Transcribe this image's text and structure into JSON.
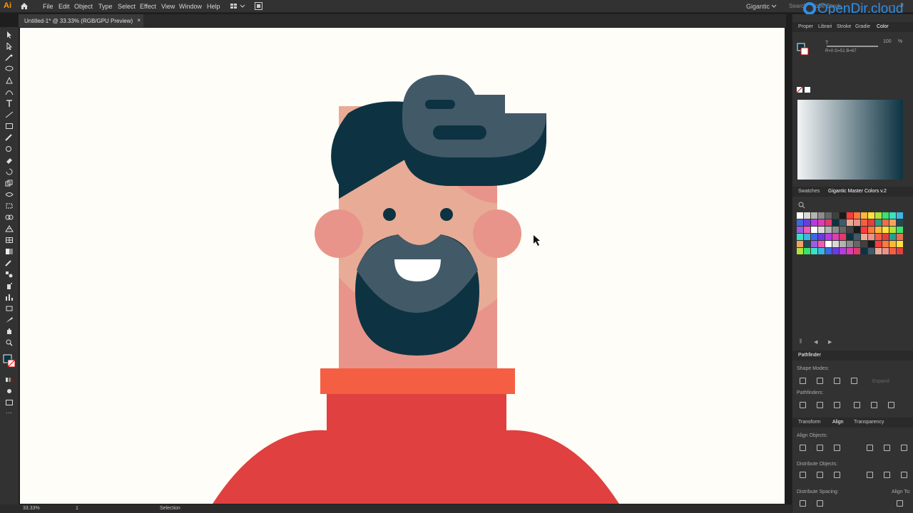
{
  "app": {
    "logo": "Ai",
    "workspace": "Gigantic",
    "search_placeholder": "Search Adobe Stock"
  },
  "menu": [
    "File",
    "Edit",
    "Object",
    "Type",
    "Select",
    "Effect",
    "View",
    "Window",
    "Help"
  ],
  "watermark": "OpenDir.cloud",
  "document_tab": {
    "title": "Untitled-1* @ 33.33% (RGB/GPU Preview)",
    "close": "×"
  },
  "status": {
    "zoom": "33.33%",
    "artboard": "1",
    "tool": "Selection"
  },
  "panels": {
    "top_tabs": [
      "Proper",
      "Librari",
      "Stroke",
      "Gradie",
      "Color"
    ],
    "active_top_tab": "Color",
    "color": {
      "opacity_label": "T",
      "opacity_value": "100",
      "percent": "%",
      "rgb_readout": "R=0 G=51 B=67"
    },
    "swatch_tabs": [
      "Swatches",
      "Gigantic Master Colors v.2"
    ],
    "pathfinder": {
      "title": "Pathfinder",
      "shape_modes": "Shape Modes:",
      "pathfinders": "Pathfinders:",
      "expand": "Expand"
    },
    "align_tabs": [
      "Transform",
      "Align",
      "Transparency"
    ],
    "active_align_tab": "Align",
    "align": {
      "align_objects": "Align Objects:",
      "distribute_objects": "Distribute Objects:",
      "distribute_spacing": "Distribute Spacing:",
      "align_to": "Align To:"
    }
  },
  "colors": {
    "fg": "#0d3342",
    "hair_light": "#425968",
    "skin": "#e8ac96",
    "ear": "#e9948a",
    "collar": "#f45f43",
    "sweater": "#e0403f",
    "background": "#fffdf8"
  },
  "swatch_colors": [
    "#ffffff",
    "#d9d9d9",
    "#b3b3b3",
    "#8c8c8c",
    "#666666",
    "#404040",
    "#1a1a1a",
    "#ff3b3b",
    "#ff7a3b",
    "#ffb63b",
    "#ffe23b",
    "#b3e23b",
    "#3be26a",
    "#3be2c2",
    "#3bb6e2",
    "#3b6ae2",
    "#6a3be2",
    "#b63be2",
    "#e23bb6",
    "#e23b6a",
    "#0d3342",
    "#425968",
    "#e8ac96",
    "#e9948a",
    "#f45f43",
    "#e0403f",
    "#2a9d8f",
    "#e76f51",
    "#f4a261",
    "#264653",
    "#9b5de5",
    "#f15bb5"
  ]
}
